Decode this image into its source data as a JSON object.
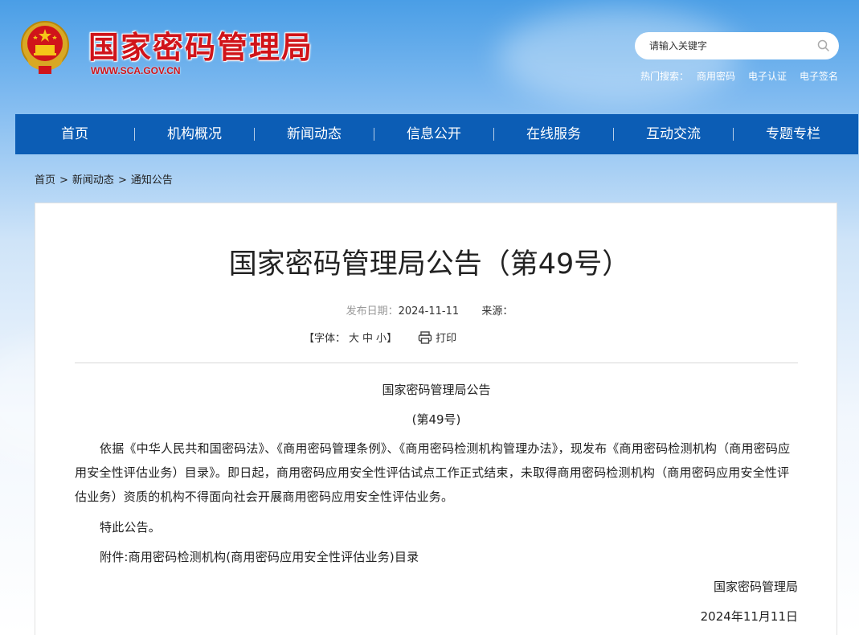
{
  "site": {
    "title": "国家密码管理局",
    "url": "WWW.SCA.GOV.CN"
  },
  "search": {
    "placeholder": "请输入关键字",
    "hot_label": "热门搜索：",
    "hot_terms": [
      "商用密码",
      "电子认证",
      "电子签名"
    ]
  },
  "nav": {
    "items": [
      "首页",
      "机构概况",
      "新闻动态",
      "信息公开",
      "在线服务",
      "互动交流",
      "专题专栏"
    ]
  },
  "breadcrumb": {
    "items": [
      "首页",
      "新闻动态",
      "通知公告"
    ],
    "separator": ">"
  },
  "article": {
    "title": "国家密码管理局公告（第49号）",
    "date_label": "发布日期：",
    "date": "2024-11-11",
    "source_label": "来源：",
    "source": "",
    "font_size_label": "【字体：",
    "font_sizes": [
      "大",
      "中",
      "小"
    ],
    "font_size_end": "】",
    "print_label": "打印",
    "heading": "国家密码管理局公告",
    "number": "(第49号)",
    "paragraph1": "依据《中华人民共和国密码法》、《商用密码管理条例》、《商用密码检测机构管理办法》，现发布《商用密码检测机构（商用密码应用安全性评估业务）目录》。即日起，商用密码应用安全性评估试点工作正式结束，未取得商用密码检测机构（商用密码应用安全性评估业务）资质的机构不得面向社会开展商用密码应用安全性评估业务。",
    "paragraph2": "特此公告。",
    "attachment": "附件:商用密码检测机构(商用密码应用安全性评估业务)目录",
    "signature": "国家密码管理局",
    "sign_date": "2024年11月11日"
  },
  "colors": {
    "brand_red": "#d0141a",
    "nav_blue": "#0c5db5"
  }
}
